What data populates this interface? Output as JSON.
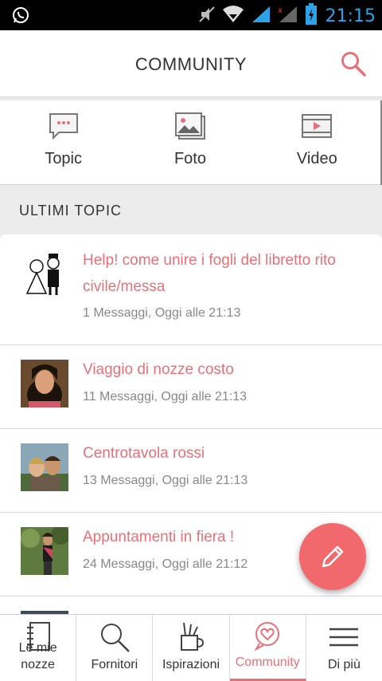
{
  "statusbar": {
    "time": "21:15"
  },
  "header": {
    "title": "COMMUNITY"
  },
  "media_tabs": [
    {
      "label": "Topic",
      "icon": "chat-bubble-icon"
    },
    {
      "label": "Foto",
      "icon": "photo-gallery-icon"
    },
    {
      "label": "Video",
      "icon": "video-film-icon"
    }
  ],
  "section": {
    "title": "ULTIMI TOPIC"
  },
  "topics": [
    {
      "title": "Help! come unire i fogli del libretto rito civile/messa",
      "meta": "1 Messaggi, Oggi alle 21:13"
    },
    {
      "title": "Viaggio di nozze costo",
      "meta": "11 Messaggi, Oggi alle 21:13"
    },
    {
      "title": "Centrotavola rossi",
      "meta": "13 Messaggi, Oggi alle 21:13"
    },
    {
      "title": "Appuntamenti in fiera !",
      "meta": "24 Messaggi, Oggi alle 21:12"
    }
  ],
  "bottom_nav": [
    {
      "label": "Le mie nozze",
      "icon": "notebook-icon"
    },
    {
      "label": "Fornitori",
      "icon": "search-icon"
    },
    {
      "label": "Ispirazioni",
      "icon": "pencil-cup-icon"
    },
    {
      "label": "Community",
      "icon": "heart-chat-icon"
    },
    {
      "label": "Di più",
      "icon": "menu-icon"
    }
  ],
  "colors": {
    "accent": "#e5717a",
    "fab": "#f2696d",
    "time": "#2ea2e6"
  }
}
